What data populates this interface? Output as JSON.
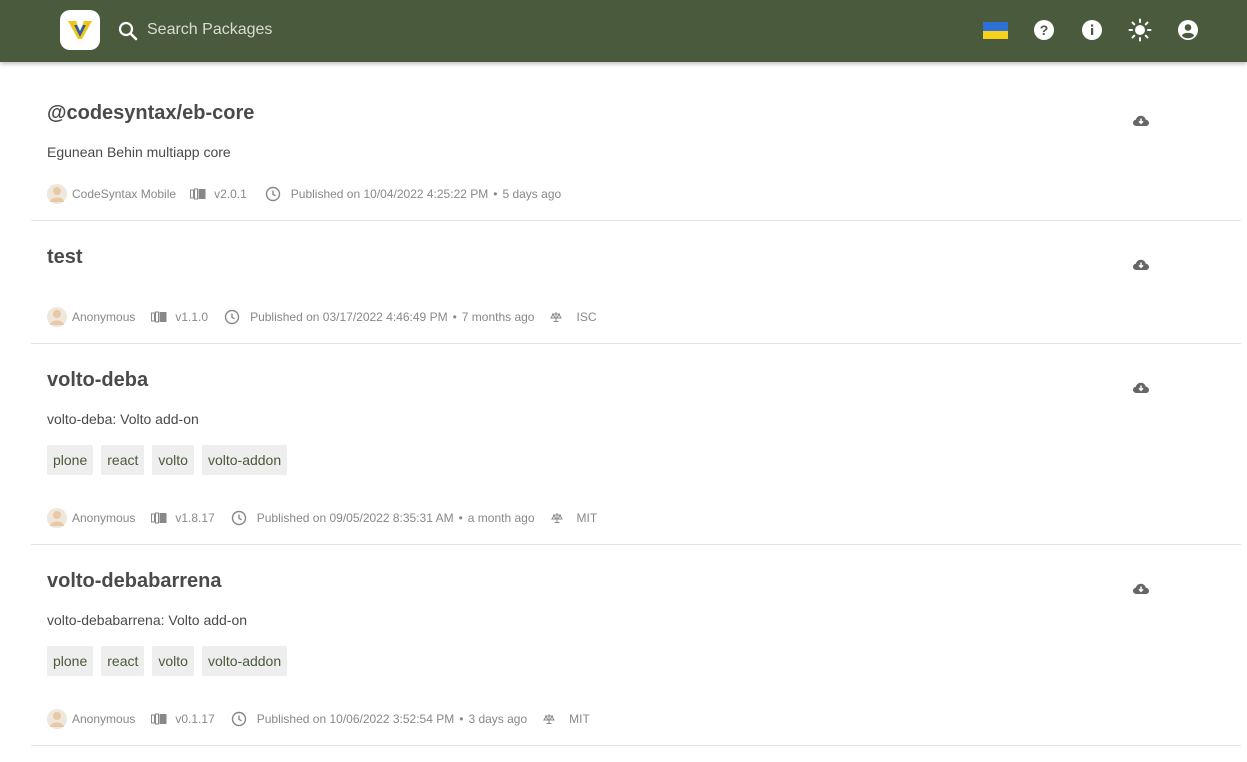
{
  "header": {
    "search_placeholder": "Search Packages",
    "accent": "#4a5a3c",
    "icons": [
      "ukraine-flag-icon",
      "help-icon",
      "info-icon",
      "theme-toggle-icon",
      "account-icon"
    ]
  },
  "packages": [
    {
      "name": "@codesyntax/eb-core",
      "description": "Egunean Behin multiapp core",
      "author": "CodeSyntax Mobile",
      "version": "v2.0.1",
      "published": "Published on 10/04/2022 4:25:22 PM",
      "bullet": "•",
      "ago": "5 days ago",
      "tags": [],
      "license": ""
    },
    {
      "name": "test",
      "description": "",
      "author": "Anonymous",
      "version": "v1.1.0",
      "published": "Published on 03/17/2022 4:46:49 PM",
      "bullet": "•",
      "ago": "7 months ago",
      "tags": [],
      "license": "ISC"
    },
    {
      "name": "volto-deba",
      "description": "volto-deba: Volto add-on",
      "author": "Anonymous",
      "version": "v1.8.17",
      "published": "Published on 09/05/2022 8:35:31 AM",
      "bullet": "•",
      "ago": "a month ago",
      "tags": [
        "plone",
        "react",
        "volto",
        "volto-addon"
      ],
      "license": "MIT"
    },
    {
      "name": "volto-debabarrena",
      "description": "volto-debabarrena: Volto add-on",
      "author": "Anonymous",
      "version": "v0.1.17",
      "published": "Published on 10/06/2022 3:52:54 PM",
      "bullet": "•",
      "ago": "3 days ago",
      "tags": [
        "plone",
        "react",
        "volto",
        "volto-addon"
      ],
      "license": "MIT"
    }
  ]
}
